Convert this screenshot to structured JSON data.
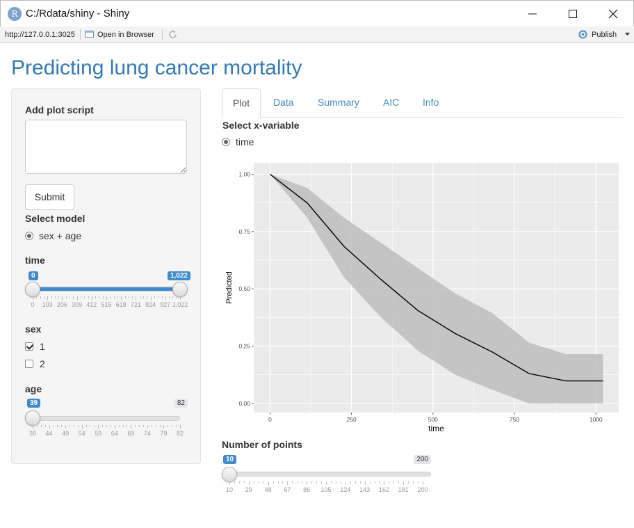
{
  "window": {
    "title": "C:/Rdata/shiny - Shiny",
    "icon_letter": "R"
  },
  "toolbar": {
    "url": "http://127.0.0.1:3025",
    "open_in_browser": "Open in Browser",
    "publish": "Publish"
  },
  "app": {
    "title": "Predicting lung cancer mortality"
  },
  "sidebar": {
    "plot_script_label": "Add plot script",
    "plot_script_value": "",
    "submit_label": "Submit",
    "select_model_label": "Select model",
    "model_option": "sex + age",
    "time_slider": {
      "label": "time",
      "min": 0,
      "max": 1022,
      "from_label": "0",
      "to_label": "1,022",
      "from": 0,
      "to": 1022,
      "ticks": [
        "0",
        "103",
        "206",
        "309",
        "412",
        "515",
        "618",
        "721",
        "824",
        "927",
        "1,022"
      ]
    },
    "sex_label": "sex",
    "sex_options": [
      {
        "label": "1",
        "checked": true
      },
      {
        "label": "2",
        "checked": false
      }
    ],
    "age_slider": {
      "label": "age",
      "min": 39,
      "max": 82,
      "value": 39,
      "value_label": "39",
      "max_label": "82",
      "ticks": [
        "39",
        "44",
        "49",
        "54",
        "59",
        "64",
        "69",
        "74",
        "79",
        "82"
      ]
    }
  },
  "tabs": [
    {
      "label": "Plot",
      "active": true
    },
    {
      "label": "Data",
      "active": false
    },
    {
      "label": "Summary",
      "active": false
    },
    {
      "label": "AIC",
      "active": false
    },
    {
      "label": "Info",
      "active": false
    }
  ],
  "main": {
    "x_variable_label": "Select x-variable",
    "x_variable_option": "time",
    "points_slider": {
      "label": "Number of points",
      "min": 10,
      "max": 200,
      "value": 10,
      "value_label": "10",
      "max_label": "200",
      "ticks": [
        "10",
        "29",
        "48",
        "67",
        "86",
        "105",
        "124",
        "143",
        "162",
        "181",
        "200"
      ]
    }
  },
  "chart_data": {
    "type": "line",
    "xlabel": "time",
    "ylabel": "Predicted",
    "xlim": [
      -50,
      1070
    ],
    "ylim": [
      -0.04,
      1.05
    ],
    "x_ticks": [
      0,
      250,
      500,
      750,
      1000
    ],
    "y_ticks": [
      0.0,
      0.25,
      0.5,
      0.75,
      1.0
    ],
    "y_tick_labels": [
      "0.00",
      "0.25",
      "0.50",
      "0.75",
      "1.00"
    ],
    "grid": true,
    "series": [
      {
        "x": [
          0,
          114,
          227,
          341,
          454,
          568,
          681,
          795,
          908,
          1022
        ],
        "values": [
          1.0,
          0.875,
          0.685,
          0.54,
          0.405,
          0.305,
          0.225,
          0.13,
          0.098,
          0.098
        ],
        "upper": [
          1.0,
          0.94,
          0.81,
          0.7,
          0.59,
          0.48,
          0.395,
          0.265,
          0.215,
          0.215
        ],
        "lower": [
          1.0,
          0.81,
          0.55,
          0.375,
          0.23,
          0.125,
          0.06,
          0.0,
          0.0,
          0.0
        ]
      }
    ],
    "colors": {
      "line": "#000000",
      "band": "#bdbdbd",
      "panel": "#ebebeb",
      "grid": "#ffffff"
    }
  }
}
